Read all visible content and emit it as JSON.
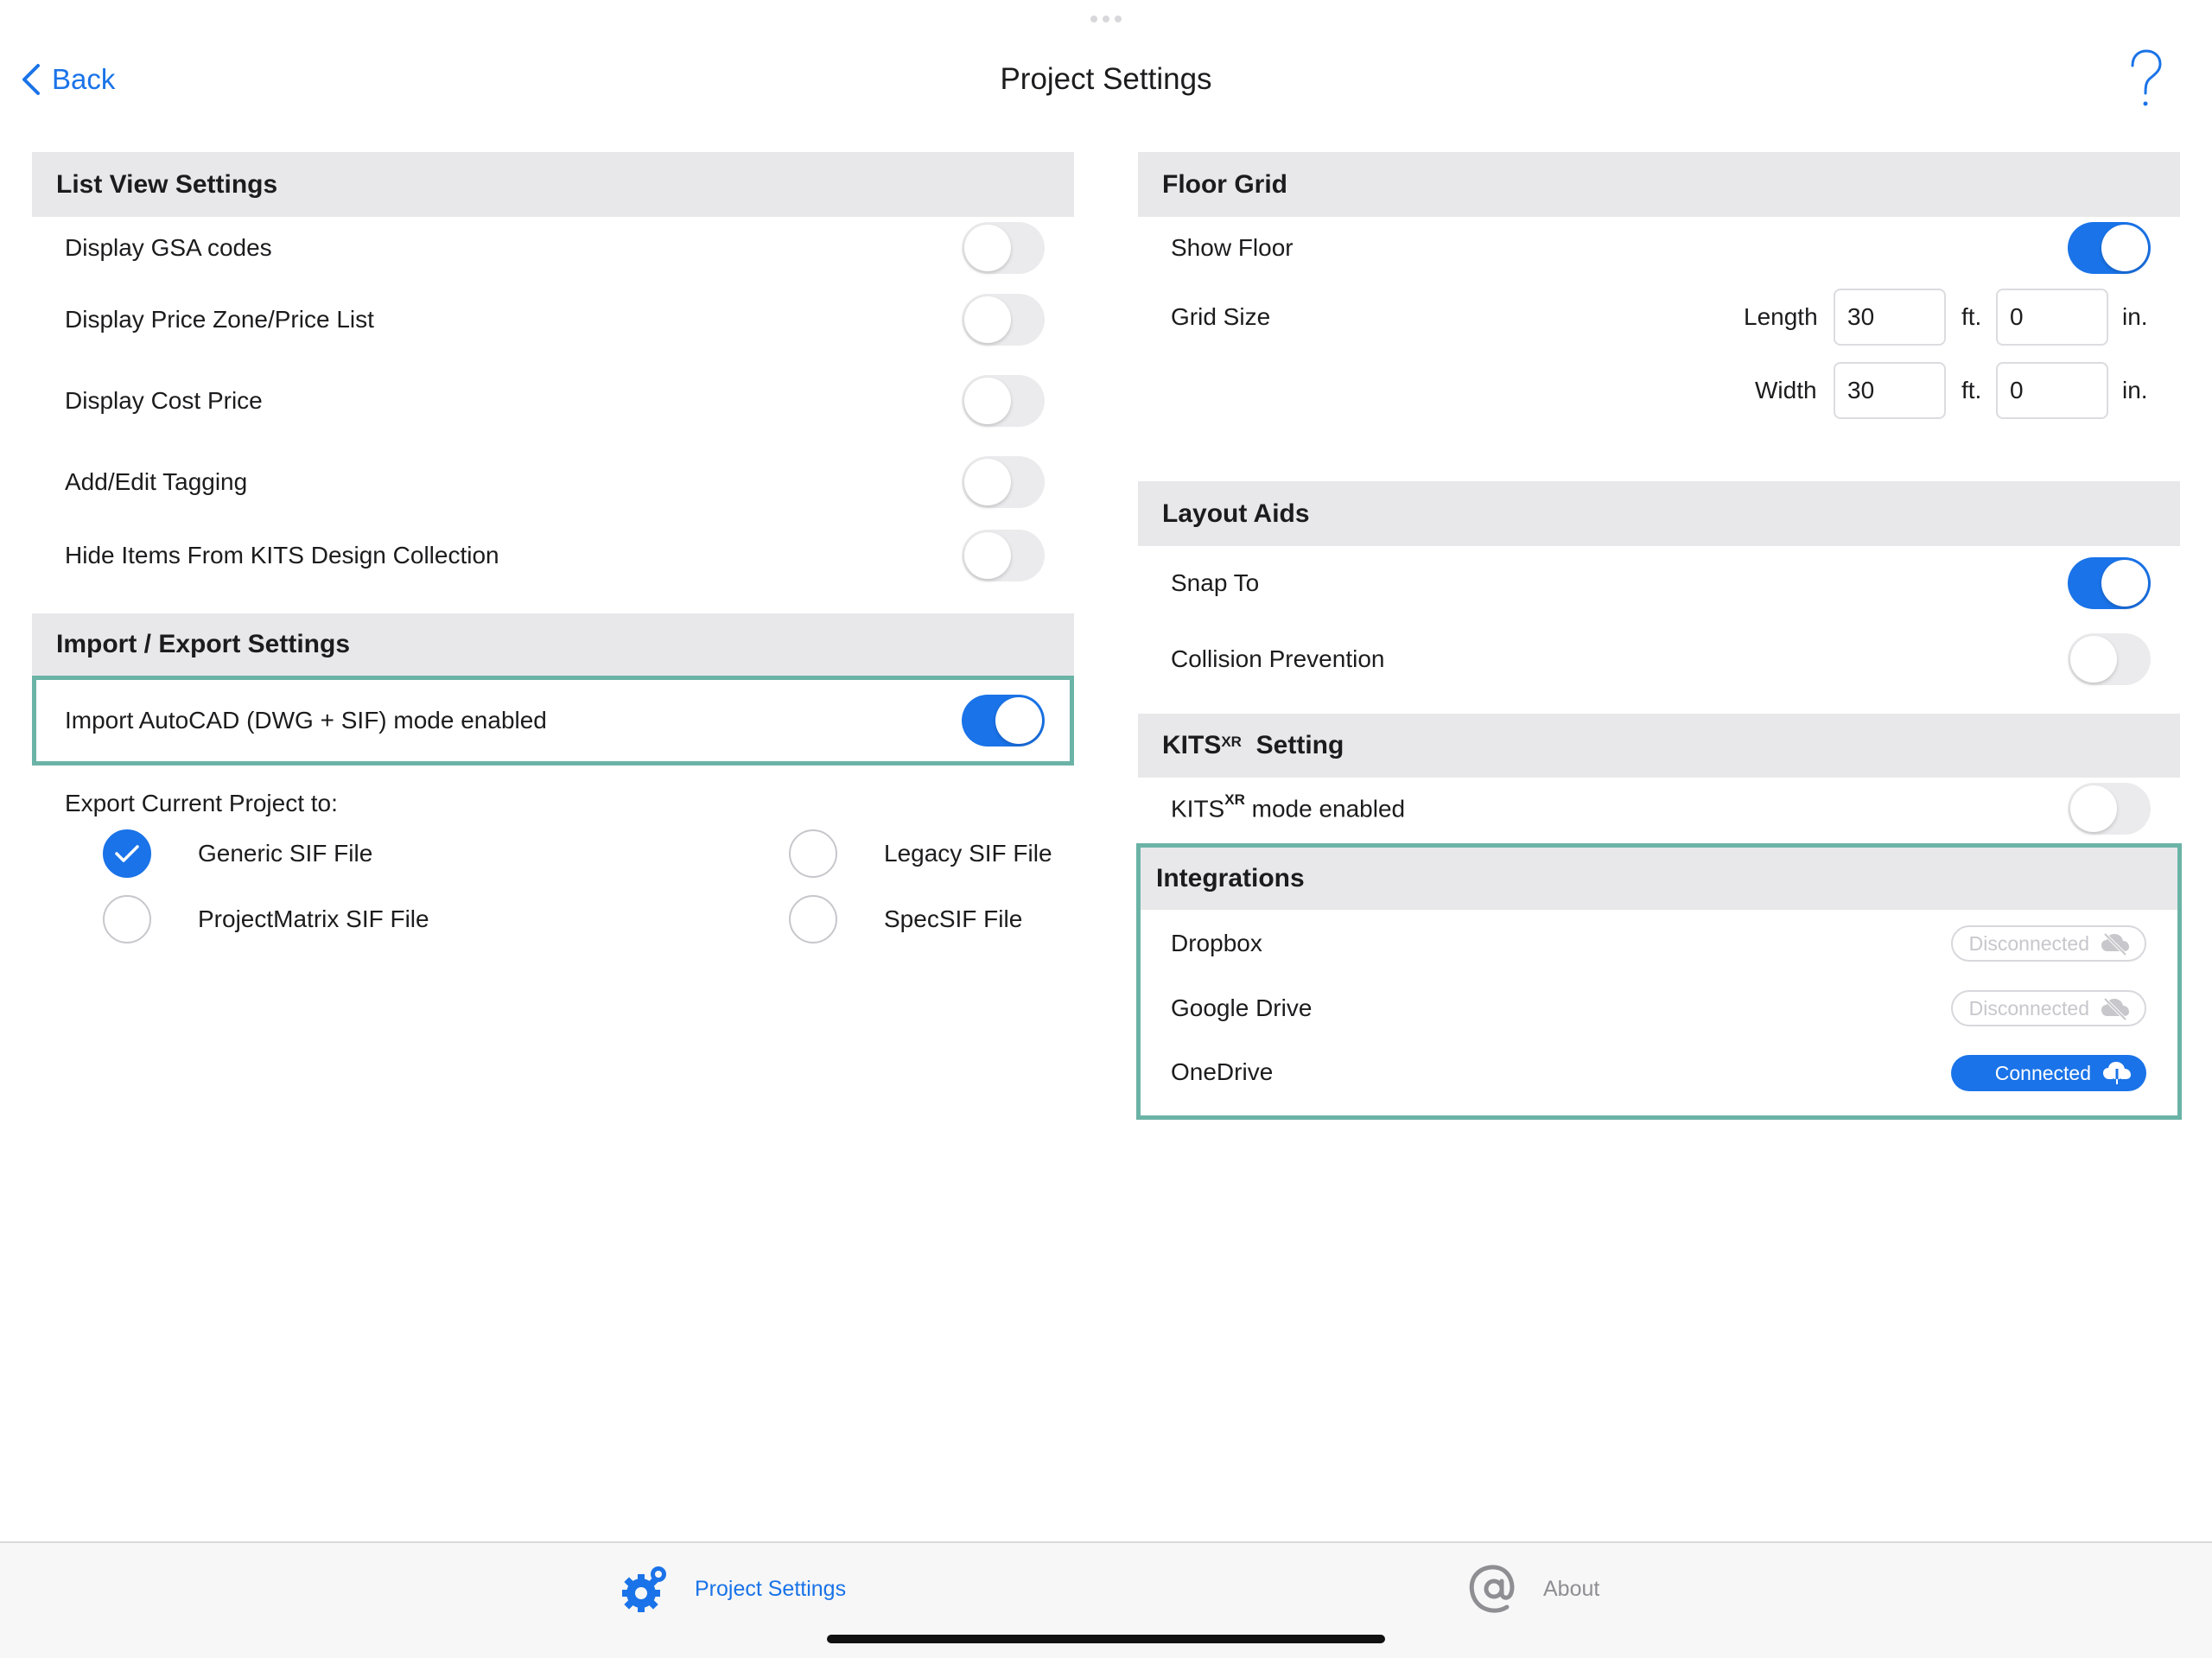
{
  "header": {
    "back_label": "Back",
    "title": "Project Settings"
  },
  "list_view": {
    "heading": "List View Settings",
    "items": [
      {
        "label": "Display GSA codes",
        "on": false
      },
      {
        "label": "Display Price Zone/Price List",
        "on": false
      },
      {
        "label": "Display Cost Price",
        "on": false
      },
      {
        "label": "Add/Edit Tagging",
        "on": false
      },
      {
        "label": "Hide Items From KITS Design Collection",
        "on": false
      }
    ]
  },
  "import_export": {
    "heading": "Import / Export Settings",
    "autocad_label": "Import AutoCAD (DWG + SIF) mode enabled",
    "autocad_on": true,
    "export_label": "Export Current Project to:",
    "options": [
      {
        "label": "Generic SIF File",
        "checked": true
      },
      {
        "label": "Legacy SIF File",
        "checked": false
      },
      {
        "label": "ProjectMatrix SIF File",
        "checked": false
      },
      {
        "label": "SpecSIF File",
        "checked": false
      }
    ]
  },
  "floor_grid": {
    "heading": "Floor Grid",
    "show_floor_label": "Show Floor",
    "show_floor_on": true,
    "grid_size_label": "Grid Size",
    "length_label": "Length",
    "width_label": "Width",
    "length_ft": "30",
    "length_in": "0",
    "width_ft": "30",
    "width_in": "0",
    "ft_unit": "ft.",
    "in_unit": "in."
  },
  "layout_aids": {
    "heading": "Layout Aids",
    "snap_label": "Snap To",
    "snap_on": true,
    "collision_label": "Collision Prevention",
    "collision_on": false
  },
  "kits_xr": {
    "heading_prefix": "KITS",
    "heading_sup": "XR",
    "heading_suffix": "Setting",
    "mode_prefix": "KITS",
    "mode_sup": "XR",
    "mode_suffix": "mode enabled",
    "mode_on": false
  },
  "integrations": {
    "heading": "Integrations",
    "items": [
      {
        "label": "Dropbox",
        "status": "Disconnected",
        "icon": "cloud-slash-icon"
      },
      {
        "label": "Google Drive",
        "status": "Disconnected",
        "icon": "cloud-slash-icon"
      },
      {
        "label": "OneDrive",
        "status": "Connected",
        "icon": "cloud-download-icon"
      }
    ]
  },
  "tabbar": {
    "tabs": [
      {
        "label": "Project Settings",
        "icon": "gear-icon",
        "active": true
      },
      {
        "label": "About",
        "icon": "at-sign-icon",
        "active": false
      }
    ]
  },
  "colors": {
    "accent": "#1a73e8",
    "highlight_border": "#6bb3a6",
    "section_bg": "#e8e8ea"
  }
}
